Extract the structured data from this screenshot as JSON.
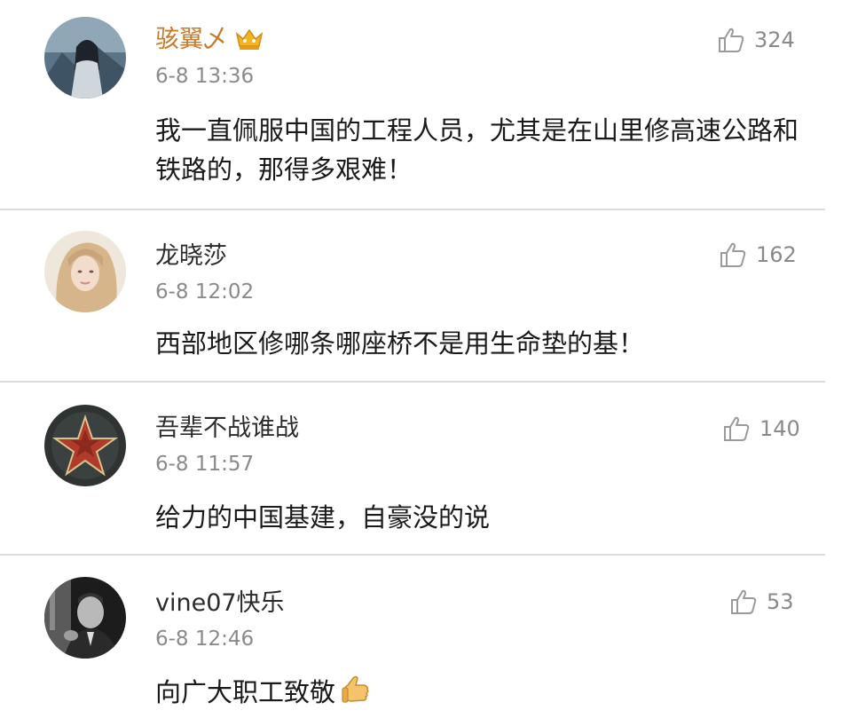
{
  "colors": {
    "username": "#2b2b2b",
    "timestamp": "#8a8a8a",
    "divider": "#dcdcdc",
    "text": "#1a1a1a"
  },
  "comments": [
    {
      "username": "骇翼乄",
      "badge": "vip-crown-icon",
      "timestamp": "6-8 13:36",
      "likes": "324",
      "text": "我一直佩服中国的工程人员，尤其是在山里修高速公路和铁路的，那得多艰难！"
    },
    {
      "username": "龙晓莎",
      "timestamp": "6-8 12:02",
      "likes": "162",
      "text": "西部地区修哪条哪座桥不是用生命垫的基！"
    },
    {
      "username": "吾辈不战谁战",
      "timestamp": "6-8 11:57",
      "likes": "140",
      "text": "给力的中国基建，自豪没的说"
    },
    {
      "username": "vine07快乐",
      "timestamp": "6-8 12:46",
      "likes": "53",
      "text": "向广大职工致敬",
      "emoji": "thumbs-up-emoji"
    }
  ]
}
